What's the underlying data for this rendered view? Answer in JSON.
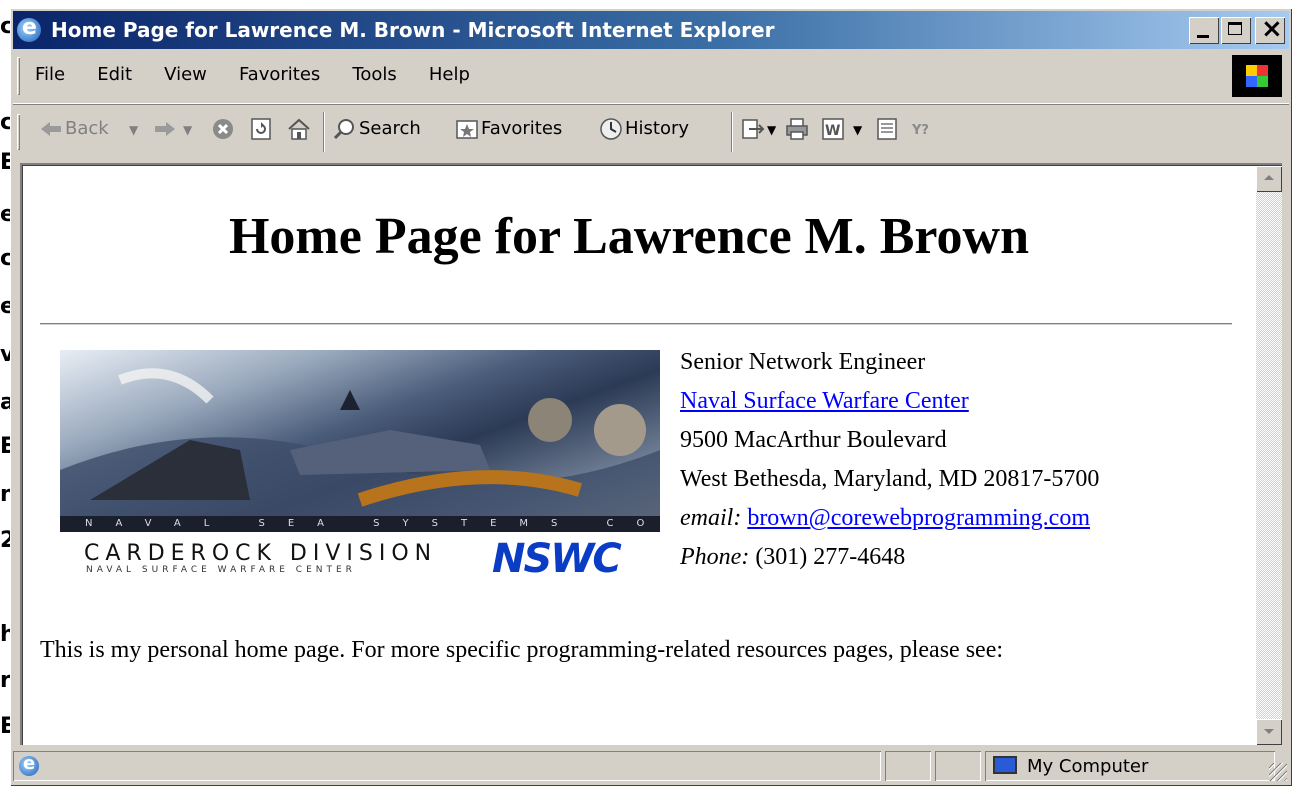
{
  "background_letters": [
    "c",
    "c",
    "E",
    "e",
    "c",
    "e",
    "v",
    "a",
    "E",
    "n",
    "2",
    "h",
    "r",
    "E"
  ],
  "window": {
    "title": "Home Page for Lawrence M. Brown - Microsoft Internet Explorer",
    "title_color": "#0a246a"
  },
  "menu": [
    "File",
    "Edit",
    "View",
    "Favorites",
    "Tools",
    "Help"
  ],
  "toolbar": {
    "back": "Back",
    "search": "Search",
    "favorites": "Favorites",
    "history": "History"
  },
  "page": {
    "heading": "Home Page for Lawrence M. Brown",
    "banner": {
      "strip_text": "NAVAL SEA SYSTEMS COMMAND",
      "division": "CARDEROCK DIVISION",
      "subtitle": "NAVAL SURFACE WARFARE CENTER",
      "logo": "NSWC"
    },
    "contact": {
      "position": "Senior Network Engineer",
      "org_link": "Naval Surface Warfare Center",
      "street": "9500 MacArthur Boulevard",
      "city": "West Bethesda, Maryland, MD 20817-5700",
      "email_label": "email:",
      "email": "brown@corewebprogramming.com",
      "phone_label": "Phone:",
      "phone": "(301) 277-4648"
    },
    "intro": "This is my personal home page. For more specific programming-related resources pages, please see:",
    "link_color": "#0000ff"
  },
  "status": {
    "text": "",
    "zone": "My Computer"
  }
}
